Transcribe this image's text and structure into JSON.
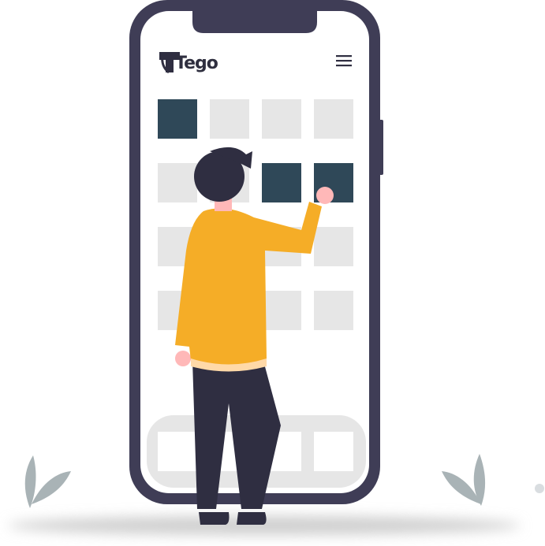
{
  "app": {
    "logo_text": "Tego",
    "logo_icon": "tego-logo-icon",
    "menu_icon": "hamburger-menu-icon"
  },
  "grid": {
    "rows": 4,
    "cols": 4,
    "selected_tiles": [
      {
        "row": 1,
        "col": 1
      },
      {
        "row": 2,
        "col": 3
      },
      {
        "row": 2,
        "col": 4
      }
    ]
  },
  "colors": {
    "phone_frame": "#3f3d56",
    "screen": "#ffffff",
    "tile_default": "#e6e6e6",
    "tile_selected": "#2f4858",
    "shirt": "#f5ad27",
    "pants": "#2f2e41",
    "hair": "#2f2e41",
    "skin": "#ffb8b8",
    "leaf": "#a9b3b6",
    "ground_shadow": "#d0d0d0"
  }
}
